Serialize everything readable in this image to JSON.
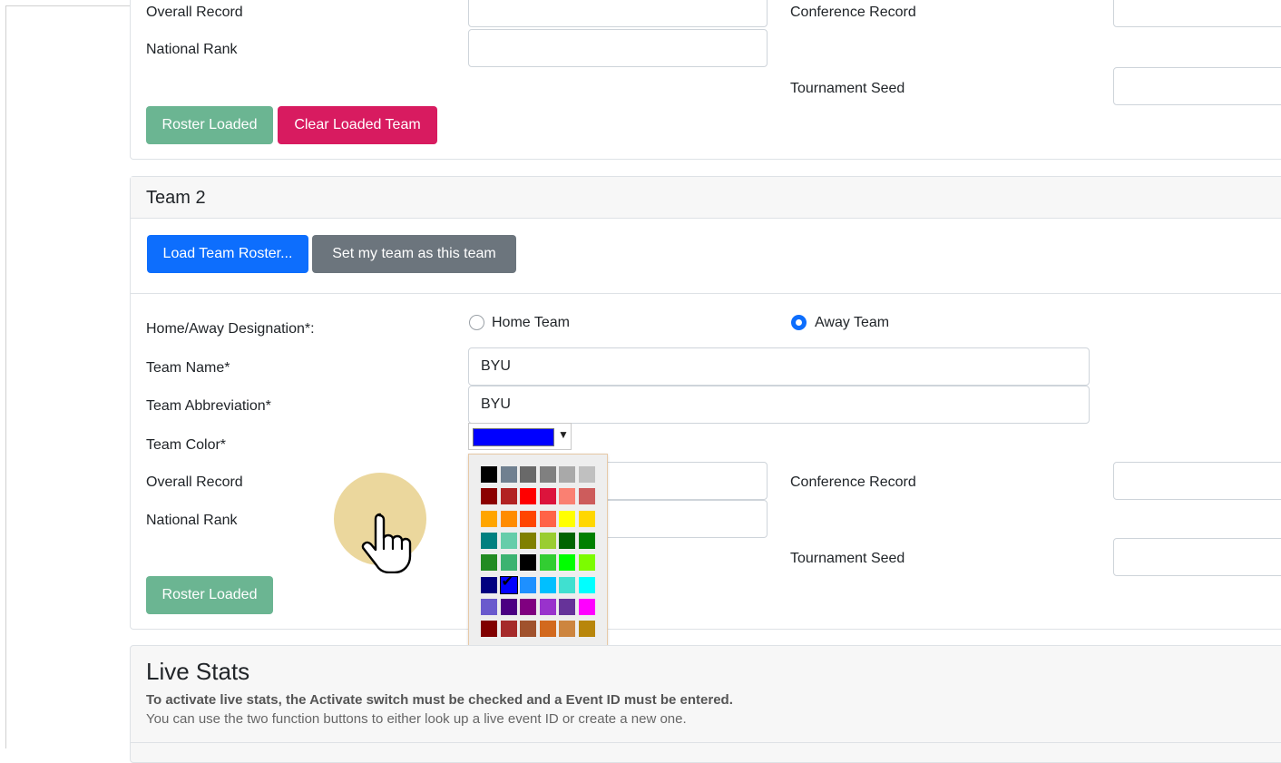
{
  "team1": {
    "overall_record_label": "Overall Record",
    "conference_record_label": "Conference Record",
    "national_rank_label": "National Rank",
    "tournament_seed_label": "Tournament Seed",
    "roster_loaded_label": "Roster Loaded",
    "clear_loaded_label": "Clear Loaded Team"
  },
  "team2": {
    "title": "Team 2",
    "load_roster_label": "Load Team Roster...",
    "set_my_team_label": "Set my team as this team",
    "home_away_label": "Home/Away Designation*:",
    "home_team_label": "Home Team",
    "away_team_label": "Away Team",
    "selected_designation": "Away Team",
    "team_name_label": "Team Name*",
    "team_name_value": "BYU",
    "team_abbr_label": "Team Abbreviation*",
    "team_abbr_value": "BYU",
    "team_color_label": "Team Color*",
    "team_color_value": "#0000ff",
    "overall_record_label": "Overall Record",
    "conference_record_label": "Conference Record",
    "national_rank_label": "National Rank",
    "tournament_seed_label": "Tournament Seed",
    "roster_loaded_label": "Roster Loaded"
  },
  "palette": {
    "selected": "#0000ff",
    "rows": [
      [
        "#000000",
        "#708090",
        "#696969",
        "#808080",
        "#a9a9a9",
        "#c0c0c0"
      ],
      [
        "#8b0000",
        "#b22222",
        "#ff0000",
        "#dc143c",
        "#fa8072",
        "#cd5c5c"
      ],
      [
        "#ffa500",
        "#ff8c00",
        "#ff4500",
        "#ff6347",
        "#ffff00",
        "#ffd700"
      ],
      [
        "#008080",
        "#66cdaa",
        "#808000",
        "#9acd32",
        "#006400",
        "#008000"
      ],
      [
        "#228b22",
        "#3cb371",
        "#000000",
        "#32cd32",
        "#00ff00",
        "#7cfc00"
      ],
      [
        "#000080",
        "#0000ff",
        "#1e90ff",
        "#00bfff",
        "#40e0d0",
        "#00ffff"
      ],
      [
        "#6a5acd",
        "#4b0082",
        "#800080",
        "#9932cc",
        "#663399",
        "#ff00ff"
      ],
      [
        "#800000",
        "#a52a2a",
        "#a0522d",
        "#d2691e",
        "#cd853f",
        "#b8860b"
      ]
    ]
  },
  "live_stats": {
    "title": "Live Stats",
    "instruction_bold": "To activate live stats, the Activate switch must be checked and a Event ID must be entered.",
    "instruction": "You can use the two function buttons to either look up a live event ID or create a new one."
  }
}
